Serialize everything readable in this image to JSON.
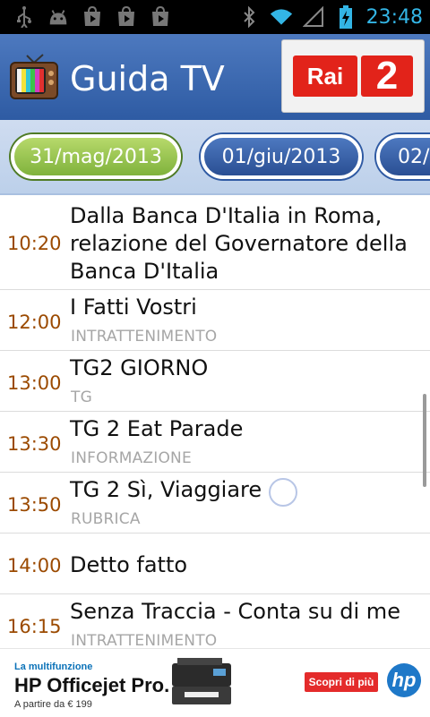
{
  "status_bar": {
    "time": "23:48",
    "left_icons": [
      "usb-icon",
      "android-icon",
      "play-store-icon",
      "play-store-icon",
      "play-store-icon"
    ],
    "right_icons": [
      "bluetooth-icon",
      "wifi-icon",
      "signal-icon",
      "battery-charging-icon"
    ],
    "accent_color": "#33b5e5"
  },
  "header": {
    "title": "Guida TV",
    "channel_logo": {
      "label": "Rai",
      "number": "2"
    }
  },
  "date_tabs": [
    {
      "label": "31/mag/2013",
      "active": true
    },
    {
      "label": "01/giu/2013",
      "active": false
    },
    {
      "label": "02/",
      "active": false
    }
  ],
  "schedule": [
    {
      "time": "10:20",
      "title_lines": [
        "Dalla Banca D'Italia in Roma,",
        "relazione del Governatore della",
        "Banca D'Italia"
      ],
      "genre": ""
    },
    {
      "time": "12:00",
      "title_lines": [
        "I Fatti Vostri"
      ],
      "genre": "INTRATTENIMENTO"
    },
    {
      "time": "13:00",
      "title_lines": [
        "TG2 GIORNO"
      ],
      "genre": "TG"
    },
    {
      "time": "13:30",
      "title_lines": [
        "TG 2 Eat Parade"
      ],
      "genre": "INFORMAZIONE"
    },
    {
      "time": "13:50",
      "title_lines": [
        "TG 2 Sì, Viaggiare"
      ],
      "genre": "RUBRICA"
    },
    {
      "time": "14:00",
      "title_lines": [
        "Detto fatto"
      ],
      "genre": ""
    },
    {
      "time": "16:15",
      "title_lines": [
        "Senza Traccia - Conta su di me"
      ],
      "genre": "INTRATTENIMENTO"
    }
  ],
  "ad": {
    "tagline": "La multifunzione",
    "product": "HP Officejet Pro.",
    "price": "A partire da € 199",
    "cta": "Scopri di più",
    "brand": "hp"
  }
}
